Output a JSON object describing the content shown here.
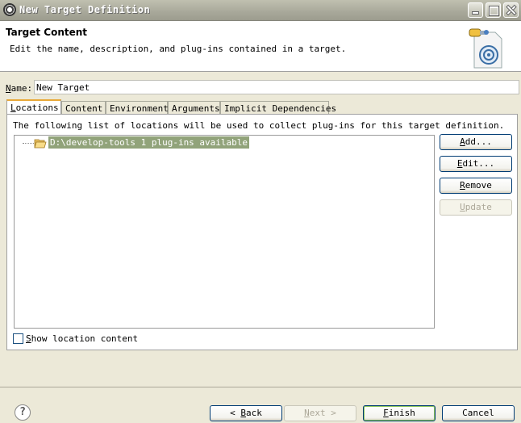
{
  "window": {
    "title": "New Target Definition"
  },
  "header": {
    "title": "Target Content",
    "description": "Edit the name, description, and plug-ins contained in a target."
  },
  "name_field": {
    "label": "Name:",
    "value": "New Target"
  },
  "tabs": [
    {
      "label": "Locations",
      "active": true
    },
    {
      "label": "Content",
      "active": false
    },
    {
      "label": "Environment",
      "active": false
    },
    {
      "label": "Arguments",
      "active": false
    },
    {
      "label": "Implicit Dependencies",
      "active": false
    }
  ],
  "locations": {
    "description": "The following list of locations will be used to collect plug-ins for this target definition.",
    "items": [
      {
        "text": "D:\\develop-tools 1 plug-ins available",
        "icon": "folder-open-icon",
        "selected": true
      }
    ],
    "buttons": {
      "add": "Add...",
      "edit": "Edit...",
      "remove": "Remove",
      "update": "Update"
    },
    "show_content_label": "Show location content",
    "show_content_checked": false
  },
  "footer": {
    "back": "< Back",
    "next": "Next >",
    "finish": "Finish",
    "cancel": "Cancel"
  },
  "colors": {
    "selection": "#91a37a",
    "active_tab_accent": "#e8a838",
    "button_border": "#003c74"
  }
}
